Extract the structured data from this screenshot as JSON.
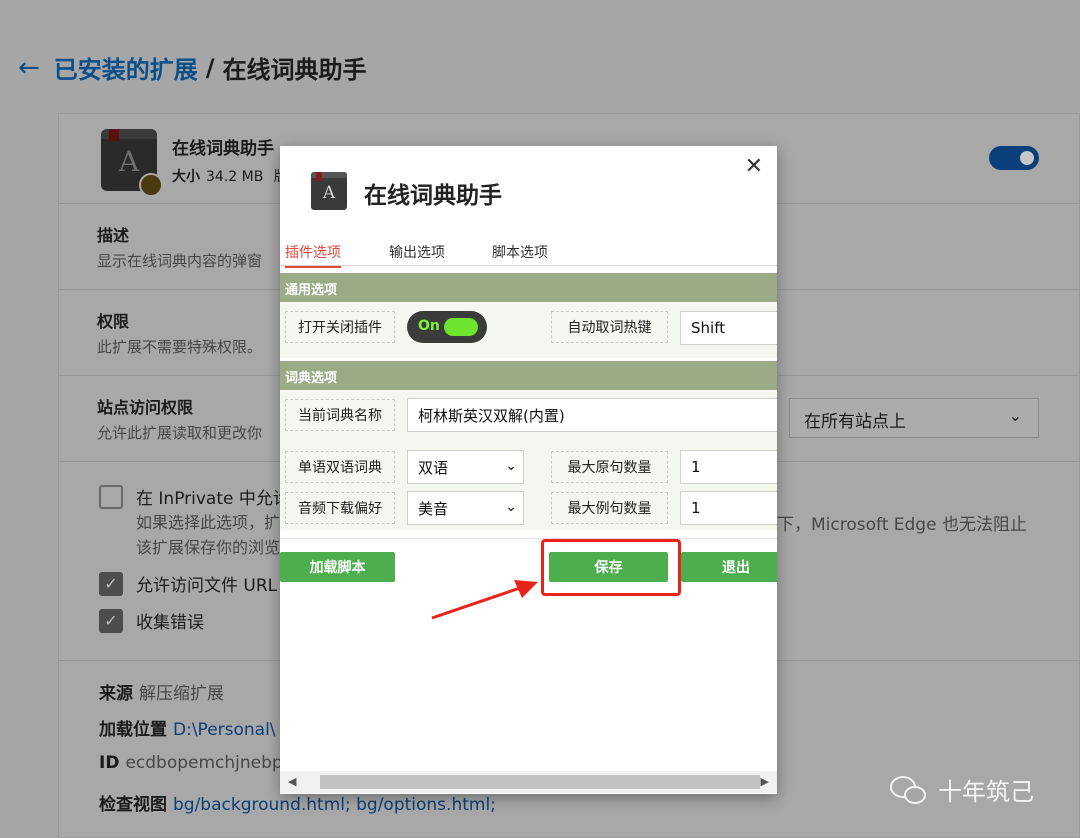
{
  "breadcrumb": {
    "back": "←",
    "parent": "已安装的扩展",
    "separator": "/",
    "current": "在线词典助手"
  },
  "extension": {
    "name": "在线词典助手",
    "size_label": "大小",
    "size_value": "34.2 MB",
    "size_trailing": "版",
    "enabled": true
  },
  "sections": {
    "description": {
      "title": "描述",
      "text": "显示在线词典内容的弹窗"
    },
    "permissions": {
      "title": "权限",
      "text": "此扩展不需要特殊权限。"
    },
    "site_access": {
      "title": "站点访问权限",
      "text": "允许此扩展读取和更改你",
      "select_value": "在所有站点上"
    },
    "inprivate": {
      "label": "在 InPrivate 中允许",
      "desc_line1": "如果选择此选项，扩",
      "desc_line1_tail": "下，Microsoft Edge 也无法阻止",
      "desc_line2": "该扩展保存你的浏览",
      "checked": false
    },
    "file_urls": {
      "label": "允许访问文件 URL",
      "checked": true
    },
    "collect_errors": {
      "label": "收集错误",
      "checked": true
    },
    "source": {
      "label": "来源",
      "value": "解压缩扩展"
    },
    "load_location": {
      "label": "加载位置",
      "value": "D:\\Personal\\"
    },
    "id": {
      "label": "ID",
      "value": "ecdbopemchjnebp"
    },
    "inspect_views": {
      "label": "检查视图",
      "value": "bg/background.html;  bg/options.html;"
    }
  },
  "dialog": {
    "title": "在线词典助手",
    "close": "✕",
    "tabs": [
      "插件选项",
      "输出选项",
      "脚本选项"
    ],
    "active_tab": 0,
    "general": {
      "heading": "通用选项",
      "toggle_label": "打开关闭插件",
      "toggle_text": "On",
      "hotkey_label": "自动取词热键",
      "hotkey_value": "Shift"
    },
    "dictionary": {
      "heading": "词典选项",
      "current_label": "当前词典名称",
      "current_value": "柯林斯英汉双解(内置)",
      "mode_label": "单语双语词典",
      "mode_value": "双语",
      "audio_label": "音频下载偏好",
      "audio_value": "美音",
      "max_orig_label": "最大原句数量",
      "max_orig_value": "1",
      "max_example_label": "最大例句数量",
      "max_example_value": "1"
    },
    "buttons": {
      "load_script": "加载脚本",
      "save": "保存",
      "exit": "退出"
    },
    "dropdown_glyph": "⌄"
  },
  "watermark": {
    "text": "十年筑己"
  },
  "colors": {
    "accent_green": "#4cae4c",
    "highlight_red": "#e8231a",
    "link_blue": "#0b4f8a"
  }
}
